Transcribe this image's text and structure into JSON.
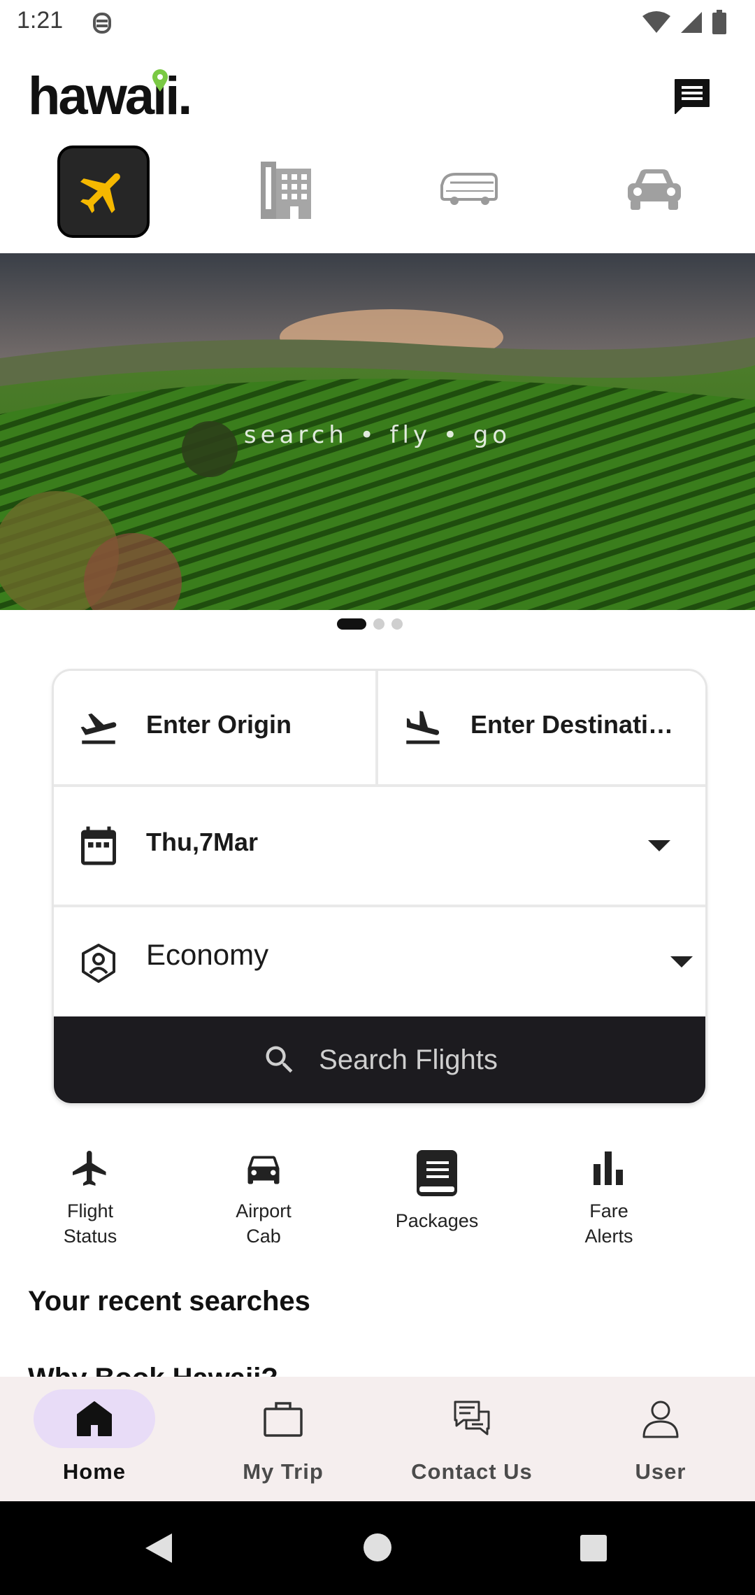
{
  "status_bar": {
    "time": "1:21"
  },
  "header": {
    "logo_text": "hawaii."
  },
  "categories": [
    {
      "name": "flight",
      "active": true
    },
    {
      "name": "hotel",
      "active": false
    },
    {
      "name": "bus",
      "active": false
    },
    {
      "name": "car",
      "active": false
    }
  ],
  "banner": {
    "caption": "search • fly • go",
    "slide_count": 3,
    "active_slide": 1
  },
  "search_form": {
    "origin_placeholder": "Enter Origin",
    "destination_placeholder": "Enter Destinati…",
    "date_value": "Thu,7Mar",
    "class_value": "Economy",
    "search_button_label": "Search Flights"
  },
  "quick_actions": [
    {
      "label": "Flight\nStatus",
      "icon": "airplane-icon"
    },
    {
      "label": "Airport\nCab",
      "icon": "car-icon"
    },
    {
      "label": "Packages",
      "icon": "book-icon"
    },
    {
      "label": "Fare\nAlerts",
      "icon": "bar-chart-icon"
    }
  ],
  "sections": {
    "recent_searches_title": "Your recent searches",
    "why_book_title": "Why Book Hawaii?"
  },
  "bottom_nav": [
    {
      "label": "Home",
      "icon": "home-icon",
      "active": true
    },
    {
      "label": "My Trip",
      "icon": "briefcase-icon",
      "active": false
    },
    {
      "label": "Contact Us",
      "icon": "chat-icon",
      "active": false
    },
    {
      "label": "User",
      "icon": "user-icon",
      "active": false
    }
  ],
  "colors": {
    "accent": "#f5b800",
    "dark": "#1c1b1f",
    "nav_bg": "#f5eeee",
    "nav_pill": "#e8dcf7",
    "logo_pin": "#7ac943"
  }
}
